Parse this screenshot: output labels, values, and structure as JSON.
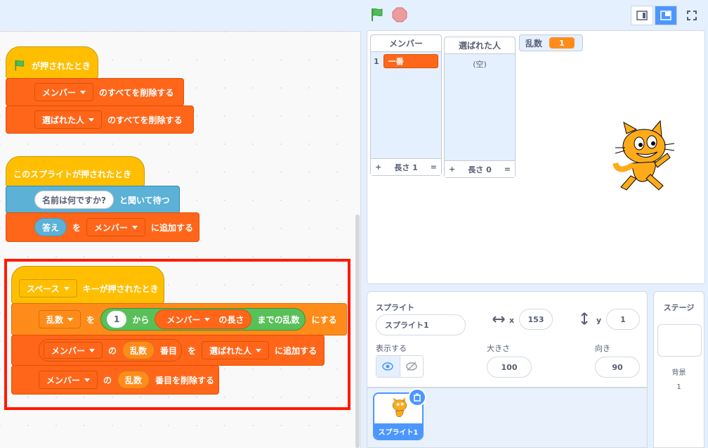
{
  "top_bar": {
    "flag_icon": "green-flag-icon",
    "stop_icon": "stop-icon"
  },
  "scripts": {
    "script1": {
      "hat_label": "が押されたとき",
      "b1_list": "メンバー",
      "b1_text": "のすべてを削除する",
      "b2_list": "選ばれた人",
      "b2_text": "のすべてを削除する"
    },
    "script2": {
      "hat_label": "このスプライトが押されたとき",
      "ask_input": "名前は何ですか?",
      "ask_text": "と聞いて待つ",
      "answer": "答え",
      "wo": "を",
      "list": "メンバー",
      "add_text": "に追加する"
    },
    "script3": {
      "key": "スペース",
      "hat_text": "キーが押されたとき",
      "set_var": "乱数",
      "set_wo": "を",
      "from_num": "1",
      "kara": "から",
      "len_list": "メンバー",
      "len_text": "の長さ",
      "made": "までの乱数",
      "ni_suru": "にする",
      "item_list": "メンバー",
      "item_no": "の",
      "item_var": "乱数",
      "item_text": "番目",
      "add_wo": "を",
      "add_list": "選ばれた人",
      "add_text": "に追加する",
      "del_list": "メンバー",
      "del_no": "の",
      "del_var": "乱数",
      "del_text": "番目を削除する"
    }
  },
  "stage": {
    "monitor_members": {
      "title": "メンバー",
      "index": "1",
      "item": "一番",
      "plus": "+",
      "length": "長さ 1",
      "eq": "="
    },
    "monitor_chosen": {
      "title": "選ばれた人",
      "empty": "(空)",
      "plus": "+",
      "length": "長さ 0",
      "eq": "="
    },
    "monitor_random": {
      "label": "乱数",
      "value": "1"
    }
  },
  "sprite_info": {
    "sprite_label": "スプライト",
    "sprite_name": "スプライト1",
    "x_label": "x",
    "x_value": "153",
    "y_label": "y",
    "y_value": "1",
    "show_label": "表示する",
    "size_label": "大きさ",
    "size_value": "100",
    "direction_label": "向き",
    "direction_value": "90"
  },
  "sprite_list": {
    "thumb_name": "スプライト1"
  },
  "stage_panel": {
    "title": "ステージ",
    "backdrop_label": "背景",
    "backdrop_count": "1"
  },
  "colors": {
    "events": "#ffbf00",
    "lists": "#ff661a",
    "variables": "#ff8c1a",
    "sensing": "#5cb1d6",
    "operators": "#59c059",
    "accent": "#4c97ff",
    "highlight": "#ff1a00"
  }
}
